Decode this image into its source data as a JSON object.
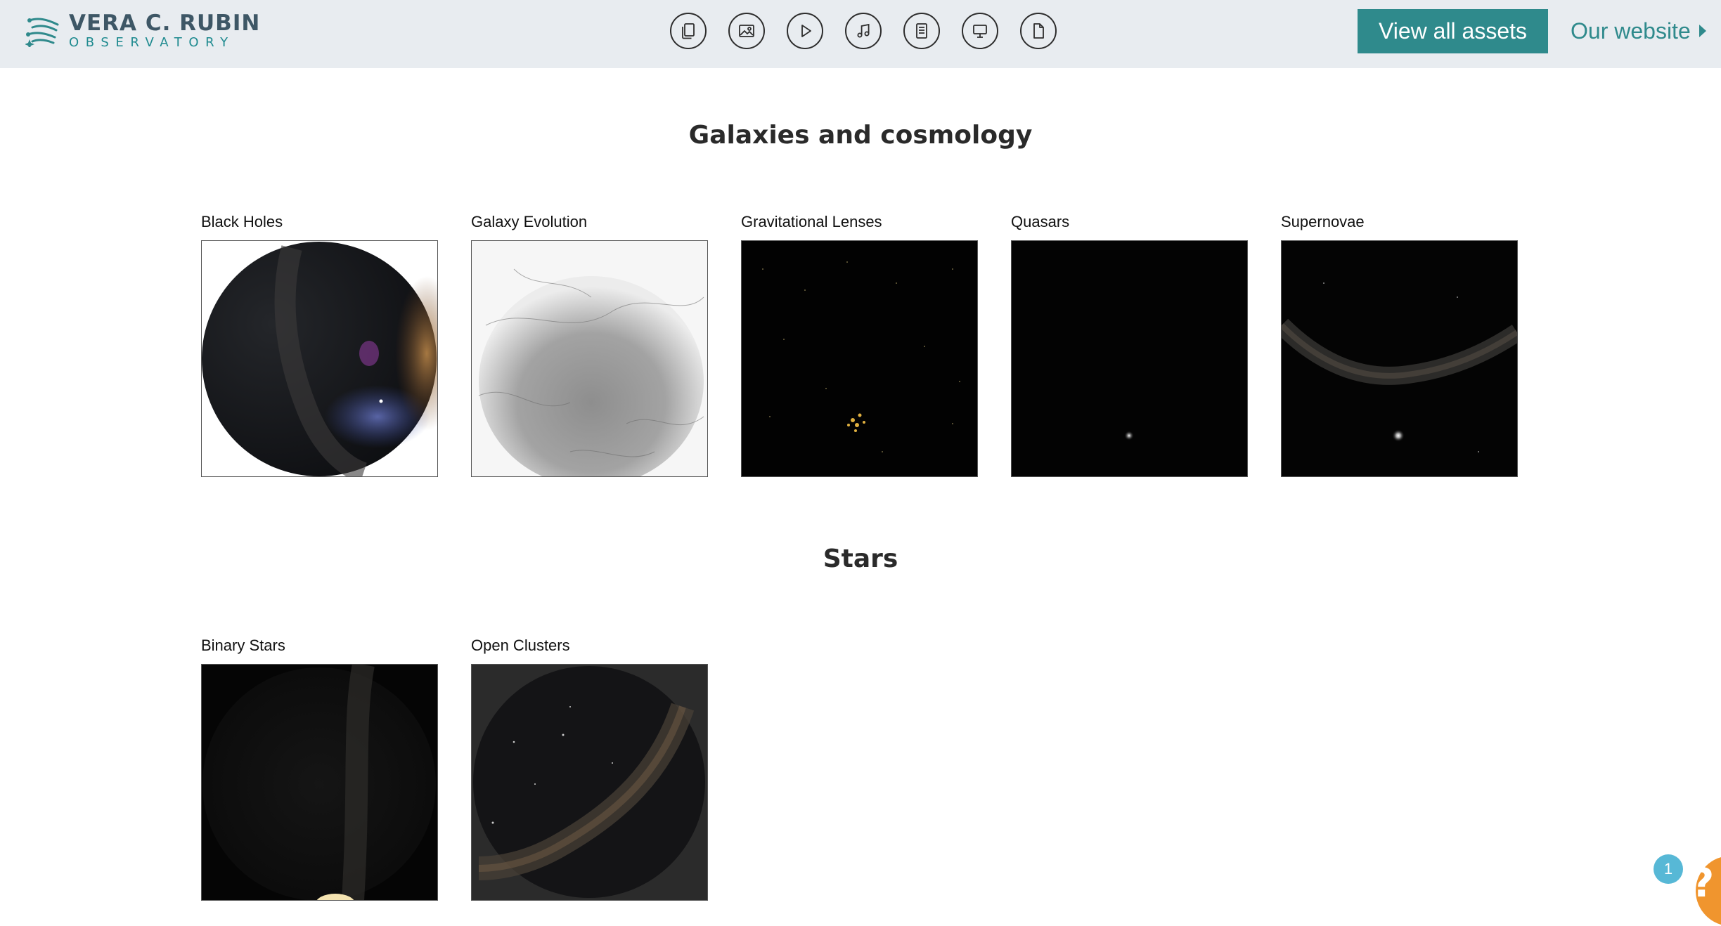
{
  "header": {
    "logo": {
      "line1": "VERA C. RUBIN",
      "line2": "OBSERVATORY"
    },
    "icons": [
      {
        "name": "documents-icon"
      },
      {
        "name": "image-icon"
      },
      {
        "name": "video-icon"
      },
      {
        "name": "audio-icon"
      },
      {
        "name": "text-document-icon"
      },
      {
        "name": "presentation-icon"
      },
      {
        "name": "file-icon"
      }
    ],
    "view_all_label": "View all assets",
    "website_label": "Our website"
  },
  "sections": [
    {
      "title": "Galaxies and cosmology",
      "cards": [
        {
          "label": "Black Holes"
        },
        {
          "label": "Galaxy Evolution"
        },
        {
          "label": "Gravitational Lenses"
        },
        {
          "label": "Quasars"
        },
        {
          "label": "Supernovae"
        }
      ]
    },
    {
      "title": "Stars",
      "cards": [
        {
          "label": "Binary Stars"
        },
        {
          "label": "Open Clusters"
        }
      ]
    }
  ],
  "help": {
    "badge_count": "1",
    "symbol": "?"
  },
  "colors": {
    "accent": "#2f8a8c",
    "header_bg": "#e8ecf0",
    "help": "#f0952e",
    "badge": "#57b8d6"
  }
}
